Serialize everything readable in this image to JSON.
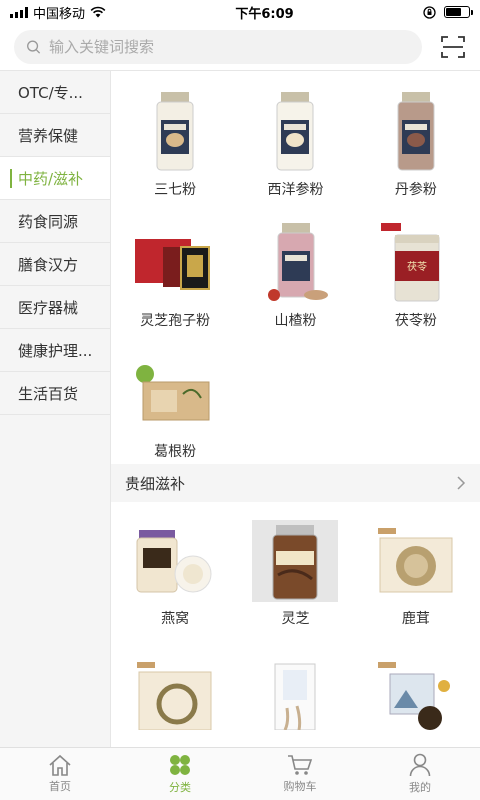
{
  "status": {
    "carrier": "中国移动",
    "time": "下午6:09"
  },
  "search": {
    "placeholder": "输入关键词搜索"
  },
  "sidebar": {
    "items": [
      {
        "label": "OTC/专..."
      },
      {
        "label": "营养保健"
      },
      {
        "label": "中药/滋补",
        "active": true
      },
      {
        "label": "药食同源"
      },
      {
        "label": "膳食汉方"
      },
      {
        "label": "医疗器械"
      },
      {
        "label": "健康护理..."
      },
      {
        "label": "生活百货"
      }
    ]
  },
  "powders": {
    "items": [
      {
        "label": "三七粉"
      },
      {
        "label": "西洋参粉"
      },
      {
        "label": "丹参粉"
      },
      {
        "label": "灵芝孢子粉"
      },
      {
        "label": "山楂粉"
      },
      {
        "label": "茯苓粉"
      },
      {
        "label": "葛根粉"
      }
    ]
  },
  "tonic_section": {
    "title": "贵细滋补"
  },
  "tonics": {
    "items": [
      {
        "label": "燕窝"
      },
      {
        "label": "灵芝"
      },
      {
        "label": "鹿茸"
      },
      {
        "label": ""
      },
      {
        "label": ""
      },
      {
        "label": ""
      }
    ]
  },
  "tabbar": {
    "home": "首页",
    "category": "分类",
    "cart": "购物车",
    "mine": "我的"
  },
  "colors": {
    "accent": "#7fb340"
  }
}
